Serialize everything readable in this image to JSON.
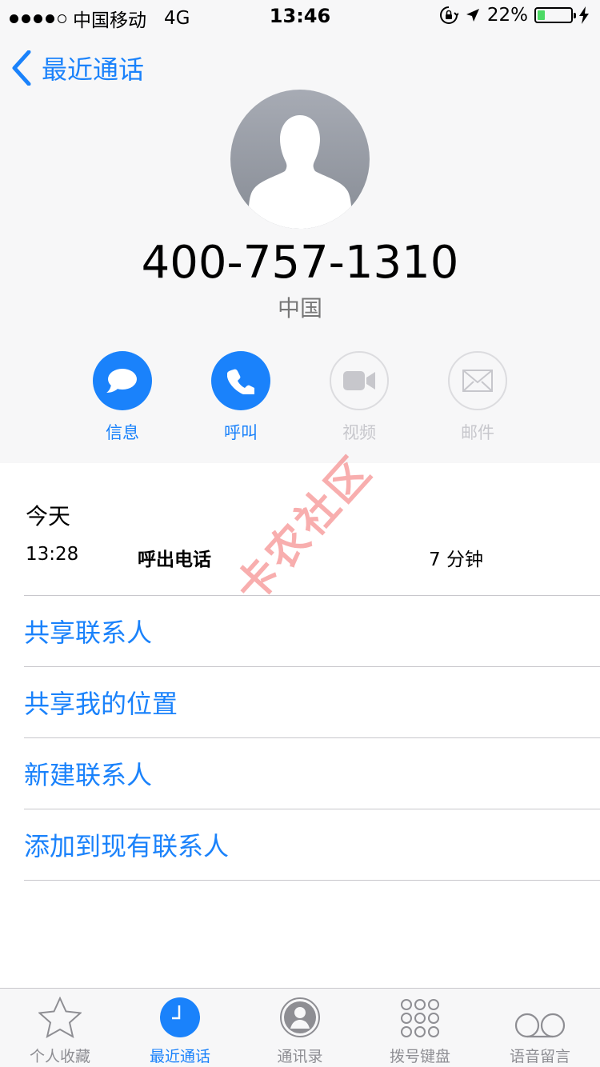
{
  "status_bar": {
    "carrier": "中国移动",
    "network": "4G",
    "time": "13:46",
    "battery": "22%",
    "battery_level": 0.22
  },
  "nav": {
    "back_label": "最近通话"
  },
  "contact": {
    "phone_number": "400-757-1310",
    "location": "中国"
  },
  "actions": [
    {
      "label": "信息",
      "icon": "message-icon",
      "enabled": true
    },
    {
      "label": "呼叫",
      "icon": "phone-icon",
      "enabled": true
    },
    {
      "label": "视频",
      "icon": "video-icon",
      "enabled": false
    },
    {
      "label": "邮件",
      "icon": "mail-icon",
      "enabled": false
    }
  ],
  "history": {
    "section": "今天",
    "time": "13:28",
    "type": "呼出电话",
    "duration": "7 分钟"
  },
  "menu": [
    "共享联系人",
    "共享我的位置",
    "新建联系人",
    "添加到现有联系人"
  ],
  "watermark": "卡农社区",
  "tabs": [
    {
      "label": "个人收藏",
      "icon": "star-icon",
      "active": false
    },
    {
      "label": "最近通话",
      "icon": "clock-icon",
      "active": true
    },
    {
      "label": "通讯录",
      "icon": "contacts-icon",
      "active": false
    },
    {
      "label": "拨号键盘",
      "icon": "keypad-icon",
      "active": false
    },
    {
      "label": "语音留言",
      "icon": "voicemail-icon",
      "active": false
    }
  ],
  "colors": {
    "accent": "#1a82fb",
    "battery": "#4cd964",
    "inactive": "#c7c7cc"
  }
}
